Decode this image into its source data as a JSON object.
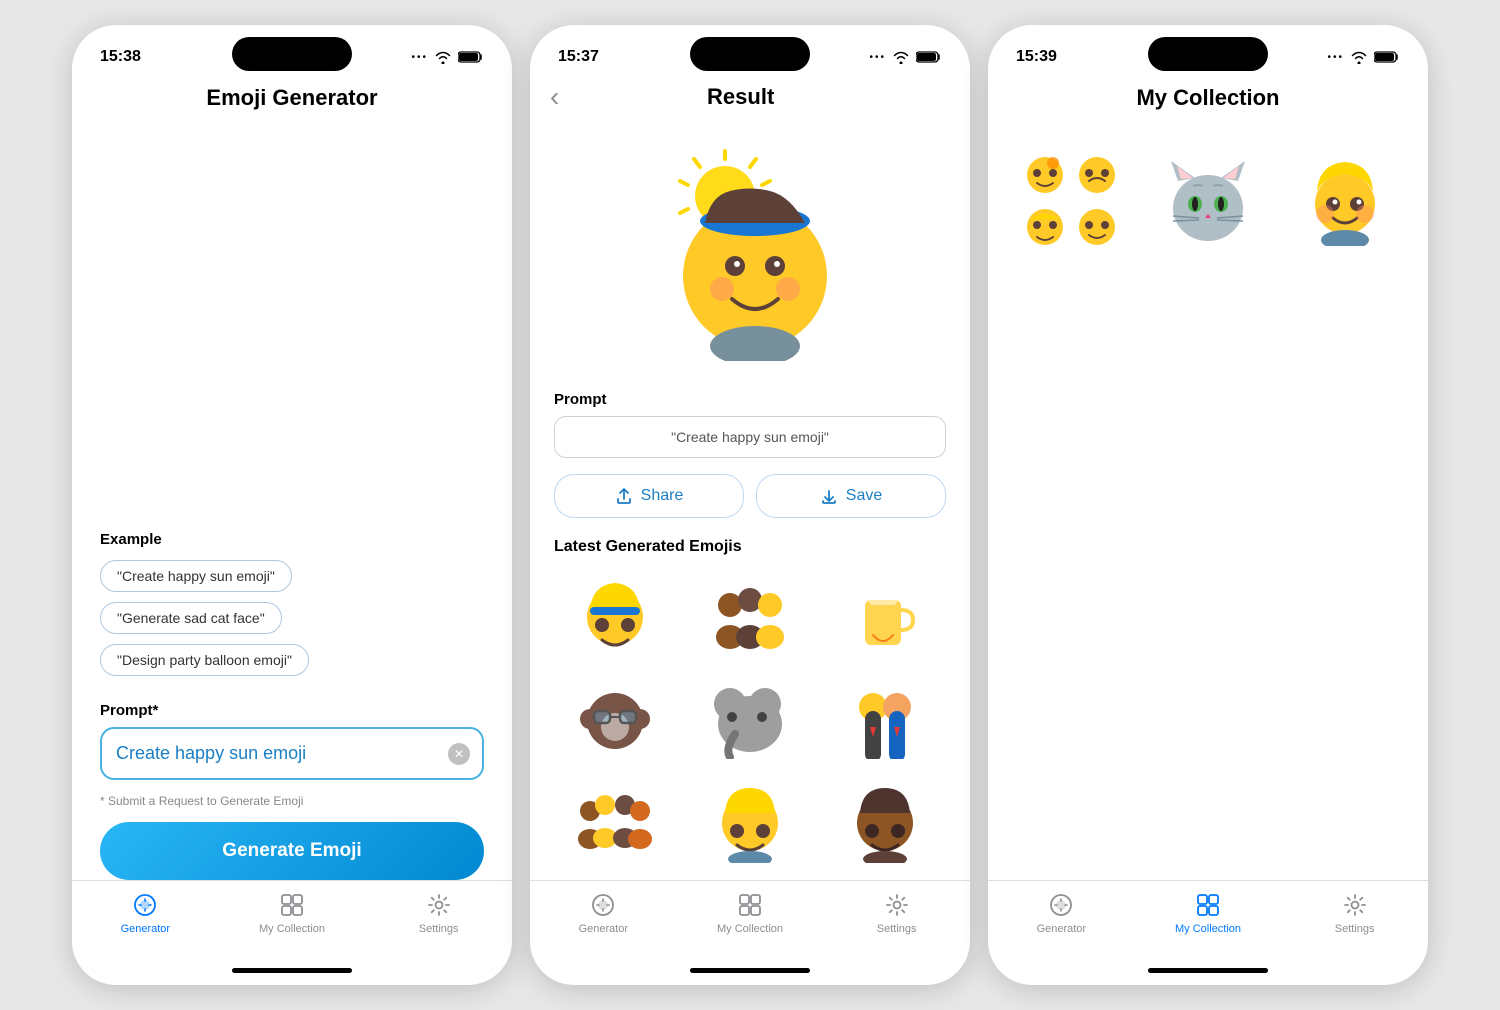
{
  "screens": [
    {
      "id": "screen1",
      "time": "15:38",
      "title": "Emoji Generator",
      "examples_label": "Example",
      "examples": [
        "\"Create happy sun emoji\"",
        "\"Generate sad cat face\"",
        "\"Design party balloon emoji\""
      ],
      "prompt_label": "Prompt*",
      "prompt_value": "Create happy sun emoji",
      "submit_hint": "* Submit a Request to Generate Emoji",
      "generate_btn": "Generate Emoji",
      "tabs": [
        {
          "label": "Generator",
          "active": true
        },
        {
          "label": "My Collection",
          "active": false
        },
        {
          "label": "Settings",
          "active": false
        }
      ]
    },
    {
      "id": "screen2",
      "time": "15:37",
      "title": "Result",
      "emoji_display": "🌟",
      "prompt_label": "Prompt",
      "prompt_value": "\"Create happy sun emoji\"",
      "share_label": "Share",
      "save_label": "Save",
      "latest_label": "Latest Generated Emojis",
      "latest_emojis": [
        "👱",
        "👨‍👧‍👦",
        "🧋",
        "🐒",
        "🐘",
        "👨‍💼",
        "👨‍👩‍👧‍👦",
        "🧑‍🦱",
        "🧑🏾"
      ],
      "tabs": [
        {
          "label": "Generator",
          "active": false
        },
        {
          "label": "My Collection",
          "active": false
        },
        {
          "label": "Settings",
          "active": false
        }
      ]
    },
    {
      "id": "screen3",
      "time": "15:39",
      "title": "My Collection",
      "collection_items": [
        {
          "type": "multi",
          "emojis": [
            "🥺",
            "🥺",
            "🥺",
            "🥺"
          ]
        },
        {
          "type": "single",
          "emoji": "🐱"
        },
        {
          "type": "single",
          "emoji": "👱"
        }
      ],
      "tabs": [
        {
          "label": "Generator",
          "active": false
        },
        {
          "label": "My Collection",
          "active": true
        },
        {
          "label": "Settings",
          "active": false
        }
      ]
    }
  ],
  "icons": {
    "back": "‹",
    "share": "⬆",
    "save": "⬇",
    "generator_tab": "🤖",
    "collection_tab": "🖼",
    "settings_tab": "⚙"
  }
}
